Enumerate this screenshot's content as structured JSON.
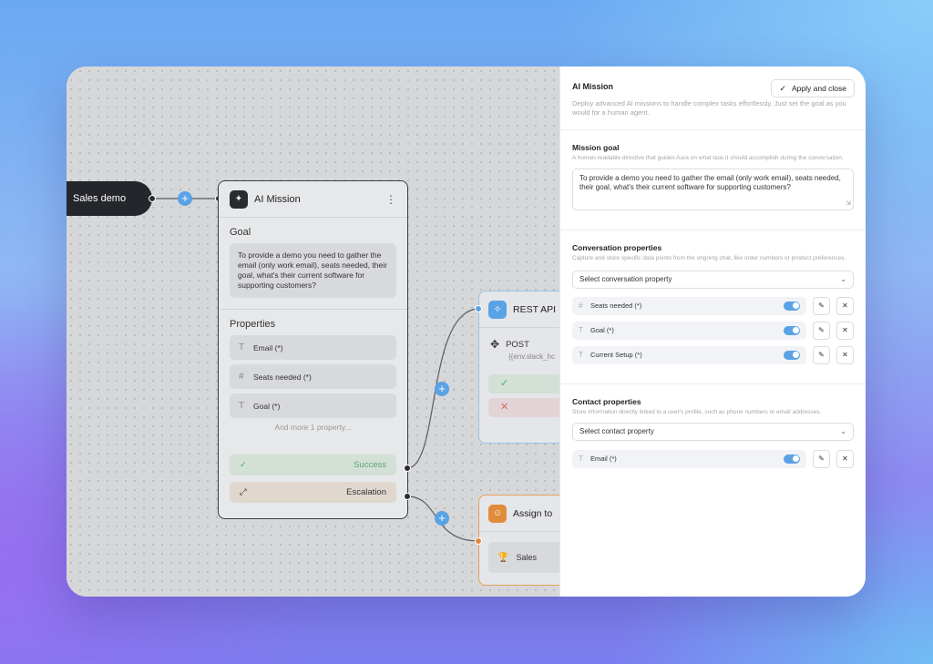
{
  "canvas": {
    "trigger": {
      "label": "Sales demo"
    },
    "mission_node": {
      "title": "AI Mission",
      "goal_heading": "Goal",
      "goal_text": "To provide a demo you need to gather the email (only work email), seats needed, their goal, what's their current software for supporting customers?",
      "properties_heading": "Properties",
      "properties": [
        {
          "label": "Email (*)",
          "icon": "text-type-icon"
        },
        {
          "label": "Seats needed (*)",
          "icon": "hash-icon"
        },
        {
          "label": "Goal (*)",
          "icon": "text-type-icon"
        }
      ],
      "more_properties": "And more 1 property...",
      "success_label": "Success",
      "escalation_label": "Escalation"
    },
    "rest_node": {
      "title": "REST API",
      "method": "POST",
      "url": "{{env.slack_hc"
    },
    "assign_node": {
      "title": "Assign to",
      "item": "Sales"
    }
  },
  "panel": {
    "title": "AI Mission",
    "apply_button": "Apply and close",
    "description": "Deploy advanced AI missions to handle complex tasks effortlessly. Just set the goal as you would for a human agent.",
    "mission_goal": {
      "heading": "Mission goal",
      "subtext": "A human-readable directive that guides Aura on what task it should accomplish during the conversation.",
      "value": "To provide a demo you need to gather the email (only work email), seats needed, their goal, what's their current software for supporting customers?"
    },
    "conversation_properties": {
      "heading": "Conversation properties",
      "subtext": "Capture and store specific data points from the ongoing chat, like order numbers or product preferences.",
      "select_placeholder": "Select conversation property",
      "items": [
        {
          "label": "Seats needed (*)",
          "icon": "hash-icon",
          "enabled": true
        },
        {
          "label": "Goal (*)",
          "icon": "text-type-icon",
          "enabled": true
        },
        {
          "label": "Current Setup (*)",
          "icon": "text-type-icon",
          "enabled": true
        }
      ]
    },
    "contact_properties": {
      "heading": "Contact properties",
      "subtext": "Store information directly linked to a user's profile, such as phone numbers or email addresses.",
      "select_placeholder": "Select contact property",
      "items": [
        {
          "label": "Email (*)",
          "icon": "text-type-icon",
          "enabled": true
        }
      ]
    }
  },
  "colors": {
    "accent": "#5aa2e6",
    "success": "#5aa776",
    "error": "#d06a6a",
    "assign": "#e08a3c"
  }
}
